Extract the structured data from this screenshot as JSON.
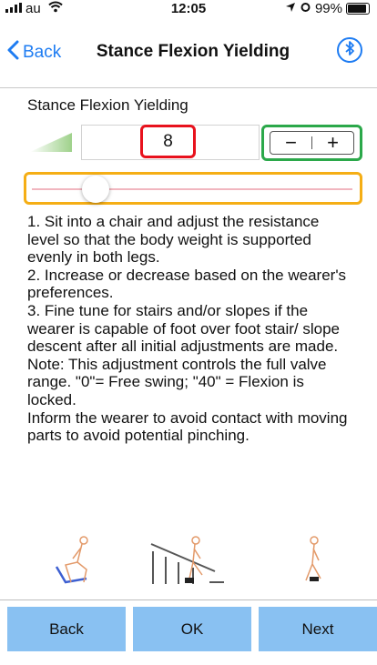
{
  "status_bar": {
    "carrier": "au",
    "time": "12:05",
    "battery": "99%",
    "battery_level": 0.99,
    "icons": [
      "signal-icon",
      "wifi-icon",
      "location-icon",
      "alarm-icon",
      "battery-icon"
    ]
  },
  "nav": {
    "back_label": "Back",
    "title": "Stance Flexion Yielding",
    "right_icon": "bluetooth-icon"
  },
  "setting": {
    "label": "Stance Flexion Yielding",
    "value": "8",
    "min": 0,
    "max": 40,
    "decrement_label": "−",
    "increment_label": "+"
  },
  "instructions": [
    "1. Sit into a chair and adjust the resistance level so that the body weight is supported evenly in both legs.",
    "2. Increase or decrease based on the wearer's preferences.",
    "3. Fine tune for stairs and/or slopes if the wearer is capable of foot over foot stair/ slope descent after all initial adjustments are made.",
    "Note: This adjustment controls the full valve range. \"0\"= Free swing; \"40\" = Flexion is locked.",
    "Inform the wearer to avoid contact with moving parts to avoid potential pinching."
  ],
  "footer": {
    "back_label": "Back",
    "ok_label": "OK",
    "next_label": "Next"
  },
  "colors": {
    "accent": "#1e7cf2",
    "button_bg": "#89c1f2",
    "value_highlight": "#e8121d",
    "stepper_highlight": "#2ba84a",
    "slider_highlight": "#f5ae15",
    "slider_track": "#f1b6bf",
    "level_wedge": "#9ed18a",
    "figure_stroke": "#e39a6a"
  }
}
